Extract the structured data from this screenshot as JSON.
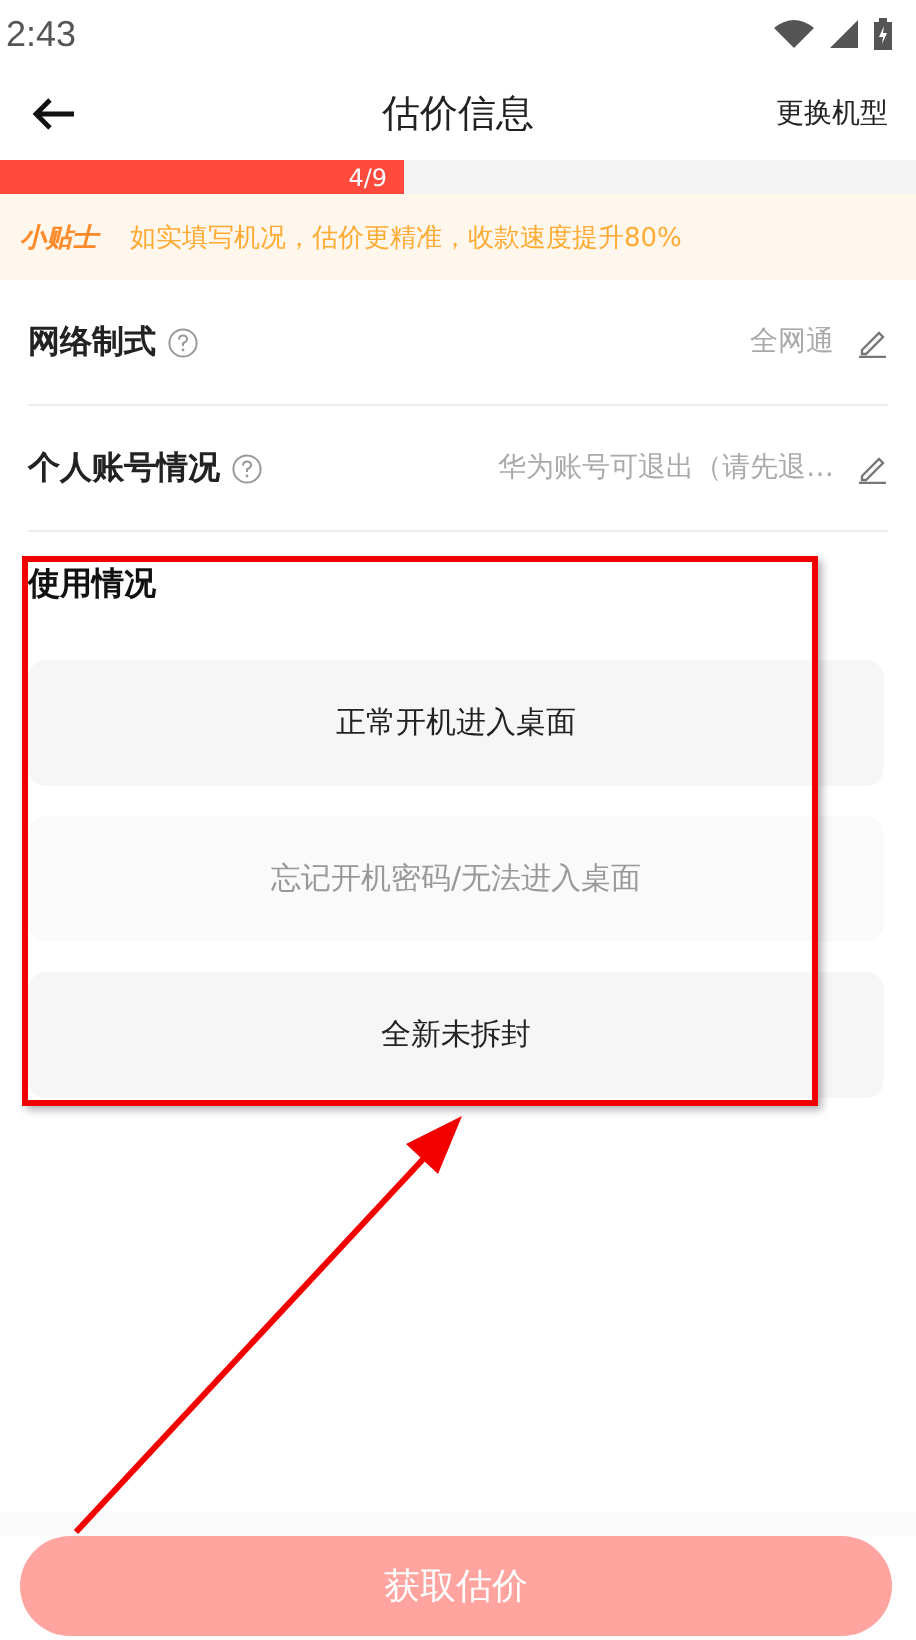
{
  "status_bar": {
    "time": "2:43"
  },
  "header": {
    "title": "估价信息",
    "action": "更换机型"
  },
  "progress": {
    "label": "4/9",
    "level": 0.44
  },
  "tip": {
    "badge": "小贴士",
    "text": "如实填写机况，估价更精准，收款速度提升80%"
  },
  "fields": [
    {
      "label": "网络制式",
      "value": "全网通"
    },
    {
      "label": "个人账号情况",
      "value": "华为账号可退出（请先退…"
    }
  ],
  "usage": {
    "title": "使用情况",
    "options": [
      {
        "label": "正常开机进入桌面",
        "disabled": false
      },
      {
        "label": "忘记开机密码/无法进入桌面",
        "disabled": true
      },
      {
        "label": "全新未拆封",
        "disabled": false
      }
    ]
  },
  "submit": {
    "label": "获取估价",
    "disabled": true
  },
  "annotation": {
    "frame": true,
    "arrow": true
  }
}
